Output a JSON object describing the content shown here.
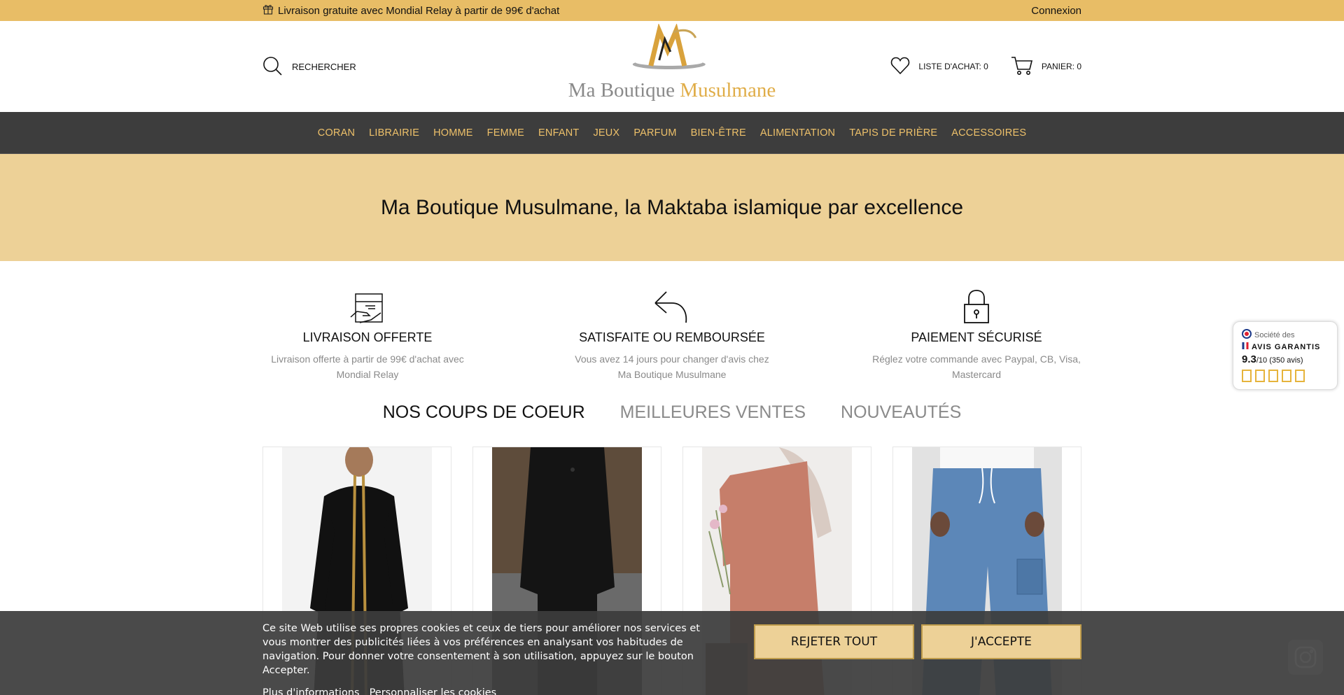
{
  "topbar": {
    "promo_icon": "gift-icon",
    "promo": "Livraison gratuite avec Mondial Relay à partir de 99€ d'achat",
    "login": "Connexion"
  },
  "header": {
    "search_label": "RECHERCHER",
    "logo_part1": "Ma Boutique ",
    "logo_part2": "Musulmane",
    "wishlist_label": "LISTE D'ACHAT: 0",
    "cart_label": "PANIER: 0"
  },
  "nav": {
    "items": [
      "CORAN",
      "LIBRAIRIE",
      "HOMME",
      "FEMME",
      "ENFANT",
      "JEUX",
      "PARFUM",
      "BIEN-ÊTRE",
      "ALIMENTATION",
      "TAPIS DE PRIÈRE",
      "ACCESSOIRES"
    ]
  },
  "hero": {
    "title": "Ma Boutique Musulmane, la Maktaba islamique par excellence"
  },
  "features": [
    {
      "icon": "delivery-box-icon",
      "title": "LIVRAISON OFFERTE",
      "text": "Livraison offerte à partir de 99€ d'achat avec Mondial Relay"
    },
    {
      "icon": "return-arrow-icon",
      "title": "SATISFAITE OU REMBOURSÉE",
      "text": "Vous avez 14 jours pour changer d'avis chez Ma Boutique Musulmane"
    },
    {
      "icon": "padlock-icon",
      "title": "PAIEMENT SÉCURISÉ",
      "text": "Réglez votre commande avec Paypal, CB, Visa, Mastercard"
    }
  ],
  "tabs": [
    "NOS COUPS DE COEUR",
    "MEILLEURES VENTES",
    "NOUVEAUTÉS"
  ],
  "reviews": {
    "line1": "Société des",
    "line2": "AVIS GARANTIS",
    "score": "9.3",
    "detail": "/10 (350 avis)"
  },
  "cookie": {
    "text": "Ce site Web utilise ses propres cookies et ceux de tiers pour améliorer nos services et vous montrer des publicités liées à vos préférences en analysant vos habitudes de navigation. Pour donner votre consentement à son utilisation, appuyez sur le bouton Accepter.",
    "link_more": "Plus d'informations",
    "link_custom": "Personnaliser les cookies",
    "reject": "REJETER TOUT",
    "accept": "J'ACCEPTE"
  },
  "colors": {
    "topbar": "#e8bd66",
    "nav_bg": "#3d3d3d",
    "nav_text": "#eec16a",
    "hero_bg": "#edd197"
  }
}
